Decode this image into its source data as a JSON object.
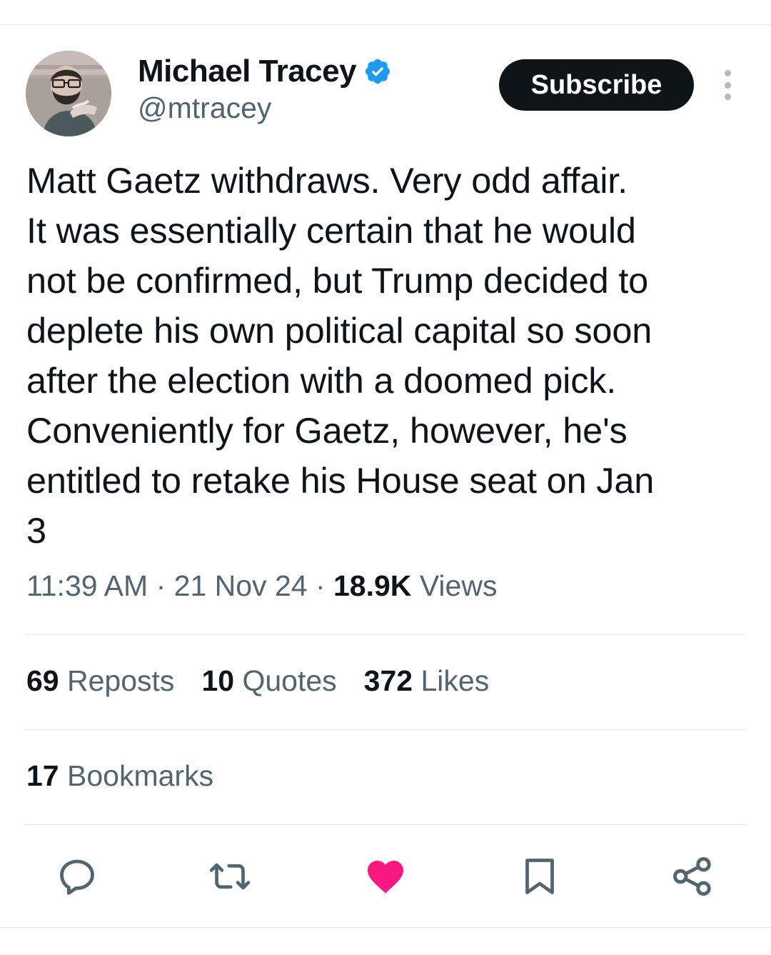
{
  "author": {
    "display_name": "Michael Tracey",
    "handle": "@mtracey",
    "verified": true,
    "verified_color": "#1d9bf0"
  },
  "header": {
    "subscribe_label": "Subscribe",
    "more_icon": "more-vertical-icon"
  },
  "tweet": {
    "text": "Matt Gaetz withdraws. Very odd affair.\nIt was essentially certain that he would\nnot be confirmed, but Trump decided to\ndeplete his own political capital so soon\nafter the election with a doomed pick.\nConveniently for Gaetz, however, he's\nentitled to retake his House seat on Jan\n3",
    "time": "11:39 AM",
    "date": "21 Nov 24",
    "views_count": "18.9K",
    "views_label": "Views"
  },
  "stats": {
    "reposts": {
      "count": "69",
      "label": "Reposts"
    },
    "quotes": {
      "count": "10",
      "label": "Quotes"
    },
    "likes": {
      "count": "372",
      "label": "Likes"
    },
    "bookmarks": {
      "count": "17",
      "label": "Bookmarks"
    }
  },
  "actions": {
    "reply_icon": "reply-icon",
    "repost_icon": "repost-icon",
    "like_icon": "heart-icon",
    "like_active": true,
    "like_color": "#f91880",
    "bookmark_icon": "bookmark-icon",
    "share_icon": "share-icon"
  }
}
